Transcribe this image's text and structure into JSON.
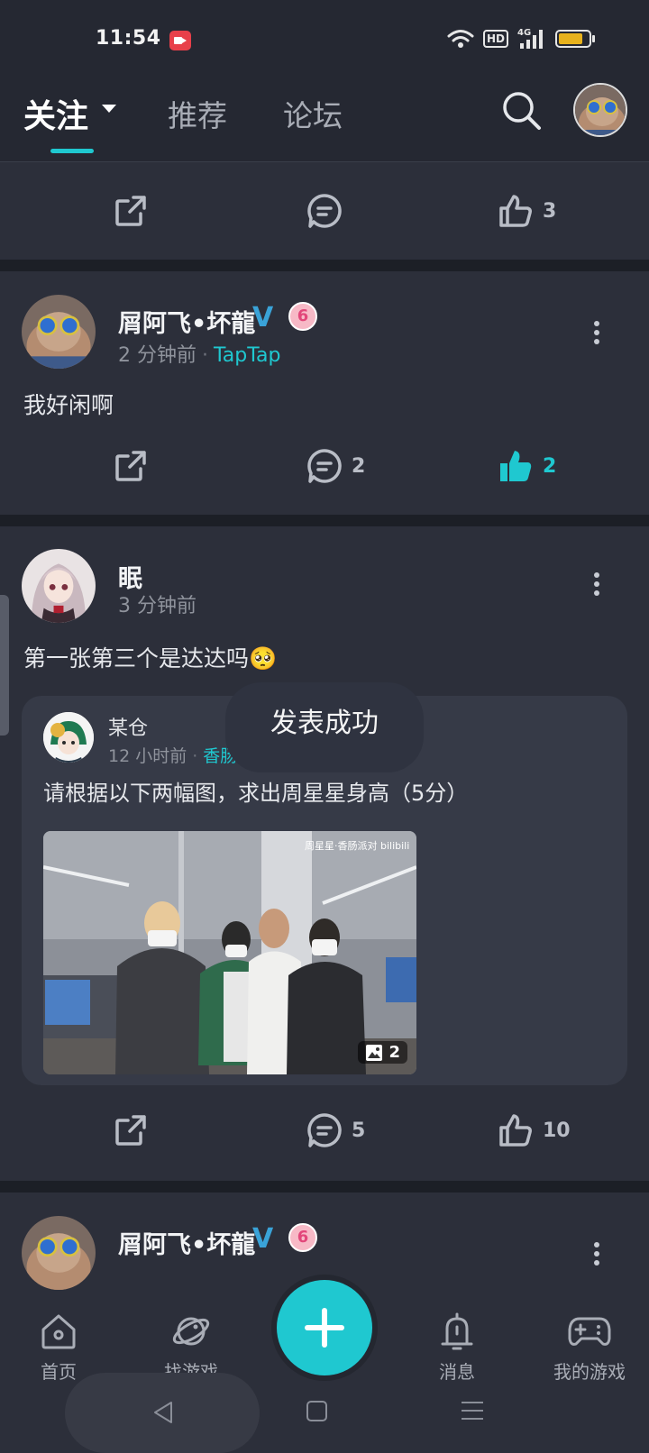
{
  "status_bar": {
    "time": "11:54",
    "hd": "HD",
    "network": "4G"
  },
  "header": {
    "tabs": [
      {
        "label": "关注",
        "active": true
      },
      {
        "label": "推荐",
        "active": false
      },
      {
        "label": "论坛",
        "active": false
      }
    ],
    "accent_color": "#1fc8d0"
  },
  "posts": [
    {
      "partial": true,
      "actions": {
        "comments": "",
        "likes": "3",
        "liked": false
      }
    },
    {
      "author": "屑阿飞•坏龍",
      "verified_mark": "V",
      "level_badge": "6",
      "time": "2 分钟前",
      "source": "TapTap",
      "text": "我好闲啊",
      "actions": {
        "comments": "2",
        "likes": "2",
        "liked": true
      }
    },
    {
      "author": "眠",
      "time": "3 分钟前",
      "text": "第一张第三个是达达吗🥺",
      "quote": {
        "author": "某仓",
        "time": "12 小时前",
        "source": "香肠派对",
        "text": "请根据以下两幅图，求出周星星身高（5分）",
        "image_count": "2",
        "image_watermark": "周星星·香肠派对 bilibili"
      },
      "actions": {
        "comments": "5",
        "likes": "10",
        "liked": false
      }
    },
    {
      "partial": true,
      "author": "屑阿飞•坏龍",
      "verified_mark": "V",
      "level_badge": "6"
    }
  ],
  "toast": "发表成功",
  "bottom_nav": [
    {
      "label": "首页",
      "icon": "home-icon"
    },
    {
      "label": "找游戏",
      "icon": "planet-icon"
    },
    {
      "label": "消息",
      "icon": "bell-icon"
    },
    {
      "label": "我的游戏",
      "icon": "gamepad-icon"
    }
  ]
}
